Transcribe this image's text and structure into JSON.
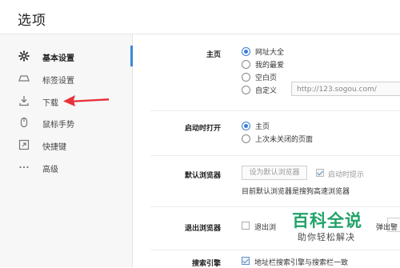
{
  "window": {
    "title": "选项"
  },
  "sidebar": {
    "items": [
      {
        "label": "基本设置",
        "icon": "gear-icon",
        "active": true
      },
      {
        "label": "标签设置",
        "icon": "tab-icon",
        "active": false
      },
      {
        "label": "下载",
        "icon": "download-icon",
        "active": false
      },
      {
        "label": "鼠标手势",
        "icon": "mouse-icon",
        "active": false
      },
      {
        "label": "快捷键",
        "icon": "shortcut-icon",
        "active": false
      },
      {
        "label": "高级",
        "icon": "more-icon",
        "active": false
      }
    ]
  },
  "homepage": {
    "label": "主页",
    "options": [
      {
        "label": "网址大全",
        "checked": true
      },
      {
        "label": "我的最爱",
        "checked": false
      },
      {
        "label": "空白页",
        "checked": false
      },
      {
        "label": "自定义",
        "checked": false
      }
    ],
    "custom_url_placeholder": "http://123.sogou.com/"
  },
  "startup": {
    "label": "启动时打开",
    "options": [
      {
        "label": "主页",
        "checked": true
      },
      {
        "label": "上次未关闭的页面",
        "checked": false
      }
    ]
  },
  "default_browser": {
    "label": "默认浏览器",
    "button_label": "设为默认浏览器",
    "startup_prompt_label": "启动时提示",
    "startup_prompt_checked": true,
    "status_text": "目前默认浏览器是搜狗高速浏览器"
  },
  "exit_browser": {
    "label": "退出浏览器",
    "option_label": "退出浏",
    "right_partial_text": "弹出警"
  },
  "search_engine": {
    "label": "搜索引擎",
    "option_label": "地址栏搜索引擎与搜索栏一致",
    "checked": true
  },
  "watermark": {
    "title": "百科全说",
    "subtitle": "助你轻松解决"
  },
  "colors": {
    "accent": "#3b7dd8",
    "arrow": "#e8313a",
    "watermark": "#22a26a"
  }
}
